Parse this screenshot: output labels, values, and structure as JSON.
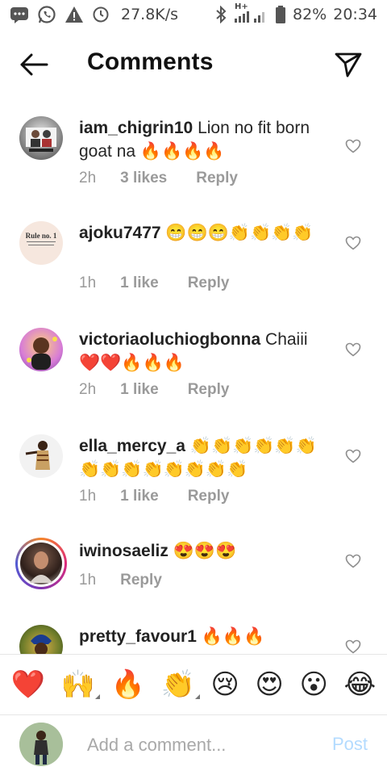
{
  "status_bar": {
    "speed": "27.8K/s",
    "network": "H+",
    "battery": "82%",
    "time": "20:34",
    "icons": [
      "chat-icon",
      "whatsapp-icon",
      "warning-icon",
      "timer-icon",
      "bluetooth-icon",
      "signal-icon",
      "battery-icon"
    ]
  },
  "header": {
    "title": "Comments",
    "back_icon": "arrow-left-icon",
    "share_icon": "paper-plane-icon"
  },
  "comments": [
    {
      "username": "iam_chigrin10",
      "text": "Lion no fit born goat na 🔥🔥🔥🔥",
      "time": "2h",
      "likes": "3 likes",
      "reply": "Reply",
      "avatar_text": ""
    },
    {
      "username": "ajoku7477",
      "text": "😁😁😁👏👏👏👏",
      "time": "1h",
      "likes": "1 like",
      "reply": "Reply",
      "avatar_text": "Rule no. 1"
    },
    {
      "username": "victoriaoluchiogbonna",
      "text": "Chaiii❤️❤️🔥🔥🔥",
      "time": "2h",
      "likes": "1 like",
      "reply": "Reply",
      "avatar_text": ""
    },
    {
      "username": "ella_mercy_a",
      "text": "👏👏👏👏👏👏👏👏👏👏👏👏👏👏",
      "time": "1h",
      "likes": "1 like",
      "reply": "Reply",
      "avatar_text": ""
    },
    {
      "username": "iwinosaeliz",
      "text": "😍😍😍",
      "time": "1h",
      "likes": "",
      "reply": "Reply",
      "avatar_text": ""
    },
    {
      "username": "pretty_favour1",
      "text": "🔥🔥🔥",
      "time": "",
      "likes": "",
      "reply": "",
      "avatar_text": ""
    }
  ],
  "emoji_bar": [
    "❤️",
    "🙌",
    "🔥",
    "👏",
    "😢",
    "😍",
    "😮",
    "😂"
  ],
  "composer": {
    "placeholder": "Add a comment...",
    "post_label": "Post"
  },
  "colors": {
    "heart": "#ed4a7b",
    "post_disabled": "#b3dbff",
    "meta": "#9a9a9a"
  }
}
